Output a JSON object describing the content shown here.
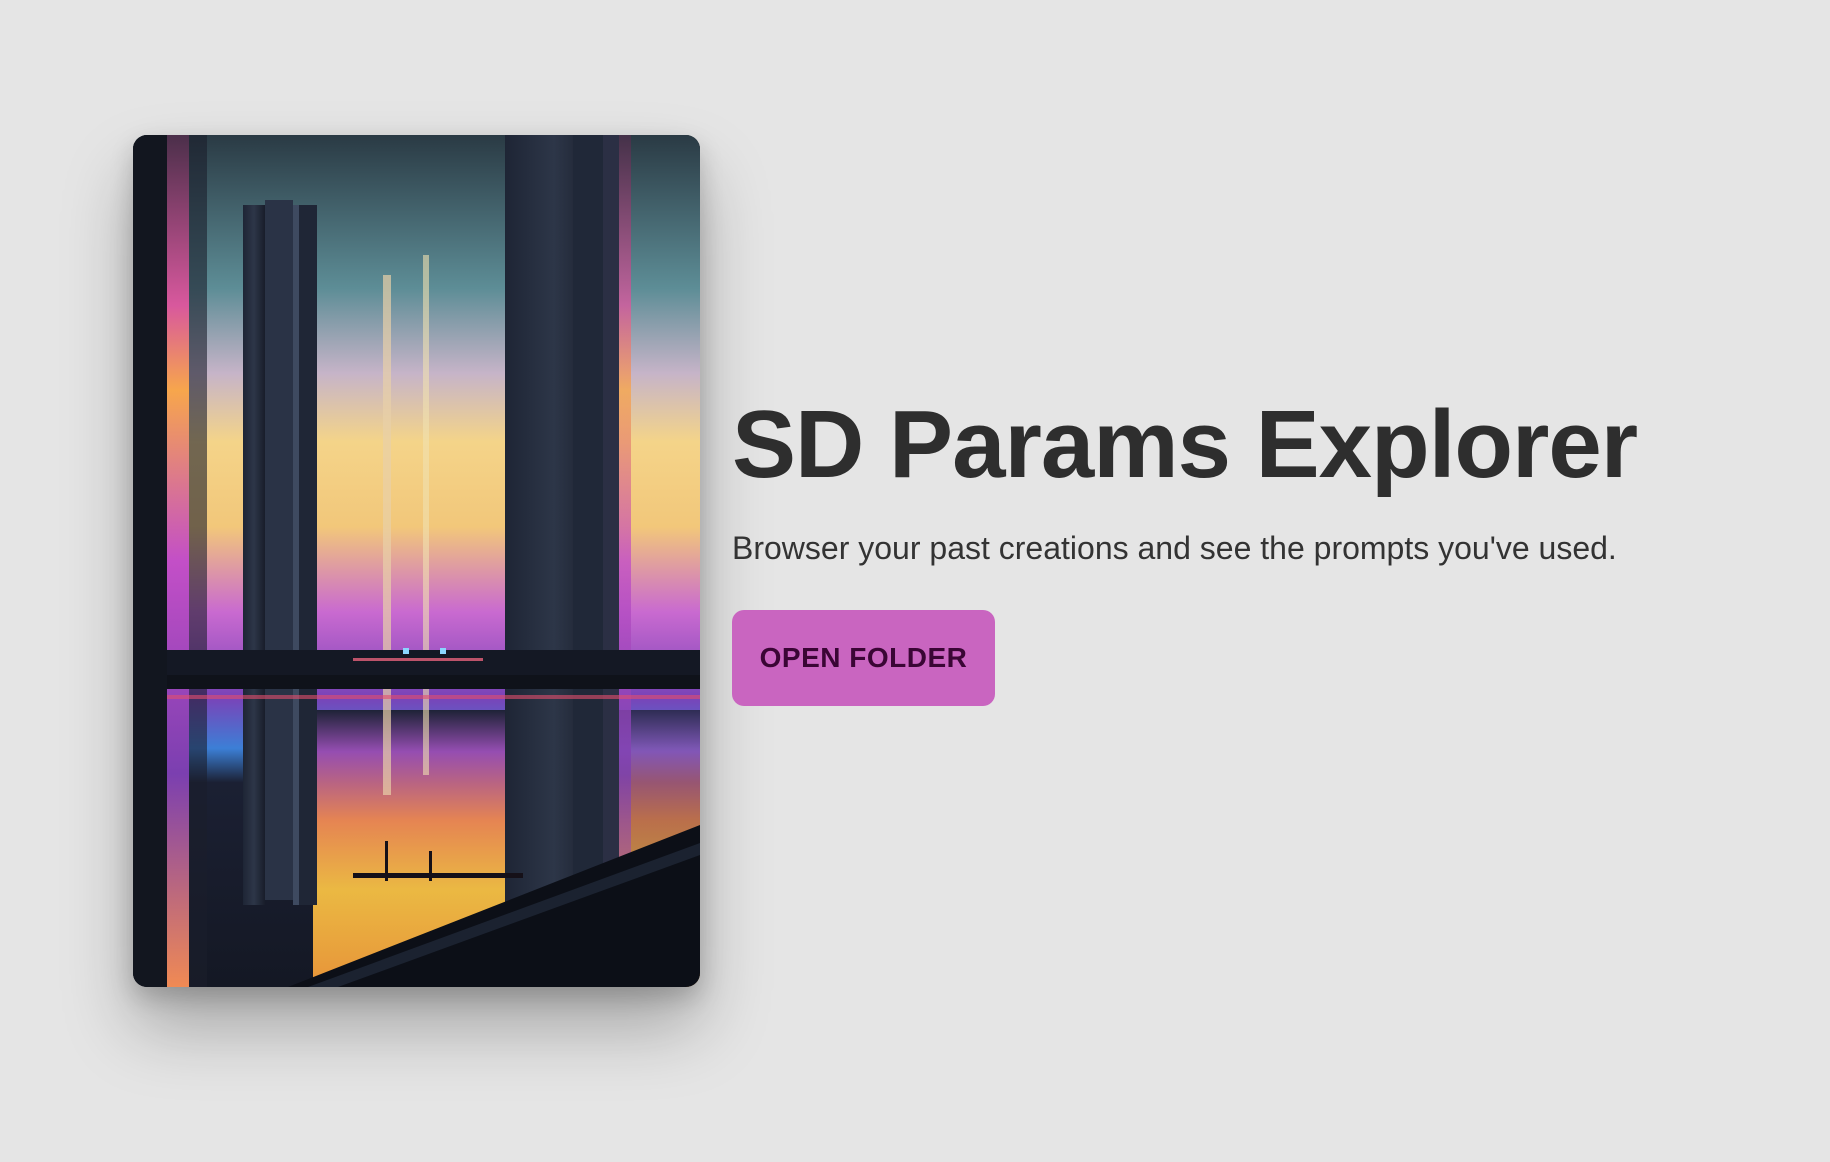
{
  "hero": {
    "title": "SD Params Explorer",
    "subtitle": "Browser your past creations and see the prompts you've used.",
    "open_folder_label": "OPEN FOLDER"
  },
  "colors": {
    "background": "#e5e5e5",
    "accent": "#c965c0",
    "accent_text": "#3a0635",
    "title_text": "#2e2e2e"
  }
}
